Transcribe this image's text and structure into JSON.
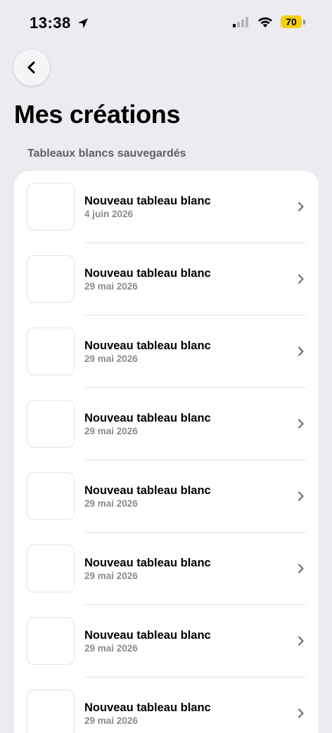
{
  "status_bar": {
    "time": "13:38",
    "battery": "70",
    "icons": [
      "location-arrow-icon",
      "cellular-signal-icon",
      "wifi-icon",
      "battery-icon"
    ]
  },
  "nav": {
    "back_icon": "chevron-left-icon"
  },
  "page": {
    "title": "Mes créations",
    "section_label": "Tableaux blancs sauvegardés"
  },
  "items": [
    {
      "title": "Nouveau tableau blanc",
      "date": "4 juin 2026"
    },
    {
      "title": "Nouveau tableau blanc",
      "date": "29 mai 2026"
    },
    {
      "title": "Nouveau tableau blanc",
      "date": "29 mai 2026"
    },
    {
      "title": "Nouveau tableau blanc",
      "date": "29 mai 2026"
    },
    {
      "title": "Nouveau tableau blanc",
      "date": "29 mai 2026"
    },
    {
      "title": "Nouveau tableau blanc",
      "date": "29 mai 2026"
    },
    {
      "title": "Nouveau tableau blanc",
      "date": "29 mai 2026"
    },
    {
      "title": "Nouveau tableau blanc",
      "date": "29 mai 2026"
    }
  ],
  "colors": {
    "background": "#ebebf0",
    "card": "#ffffff",
    "battery": "#f4cf0f",
    "secondary_text": "#8a8a90"
  }
}
